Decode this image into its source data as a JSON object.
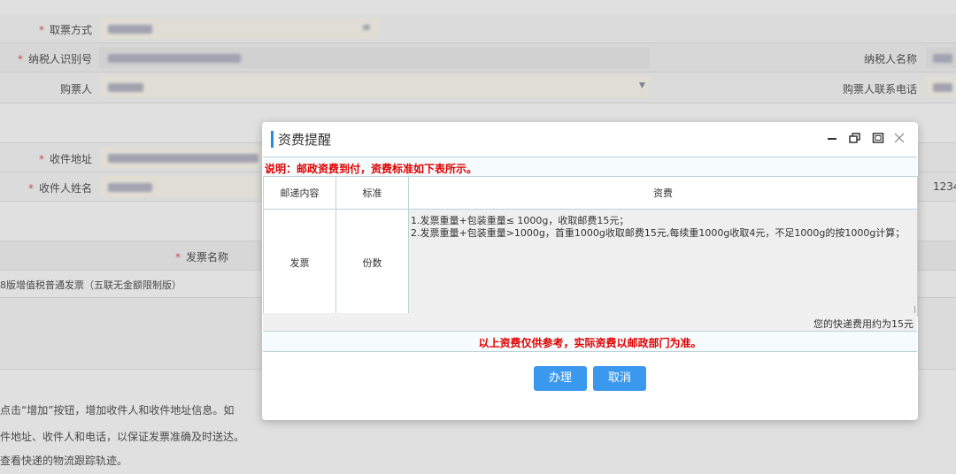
{
  "background": {
    "fields": {
      "pickup_method_label": "取票方式",
      "taxpayer_id_label": "纳税人识别号",
      "taxpayer_name_label": "纳税人名称",
      "buyer_label": "购票人",
      "buyer_phone_label": "购票人联系电话",
      "address_label": "收件地址",
      "recipient_name_label": "收件人姓名",
      "recipient_phone_partial": "1234",
      "invoice_name_label": "发票名称",
      "invoice_item": "8版增值税普通发票（五联无金额限制版）"
    },
    "notes": [
      "点击“增加”按钮，增加收件人和收件地址信息。如",
      "件地址、收件人和电话，以保证发票准确及时送达。",
      "查看快递的物流跟踪轨迹。"
    ]
  },
  "modal": {
    "title": "资费提醒",
    "explain": "说明：邮政资费到付，资费标准如下表所示。",
    "table": {
      "headers": [
        "邮递内容",
        "标准",
        "资费"
      ],
      "rows": [
        {
          "content": "发票",
          "standard": "份数",
          "fee_lines": [
            "1.发票重量+包装重量≤ 1000g，收取邮费15元；",
            "2.发票重量+包装重量>1000g，首重1000g收取邮费15元,每续重1000g收取4元，不足1000g的按1000g计算；"
          ]
        }
      ]
    },
    "estimate": "您的快递费用约为15元",
    "reference": "以上资费仅供参考，实际资费以邮政部门为准。",
    "buttons": {
      "confirm": "办理",
      "cancel": "取消"
    }
  },
  "colors": {
    "accent": "#2a8ae0",
    "button": "#3a98ef",
    "warning_text": "#e00000",
    "required_mark": "#e05a5a"
  },
  "icons": {
    "minimize": "minimize-icon",
    "restore": "restore-icon",
    "maximize": "maximize-icon",
    "close": "close-icon",
    "dropdown": "chevron-down-icon"
  }
}
